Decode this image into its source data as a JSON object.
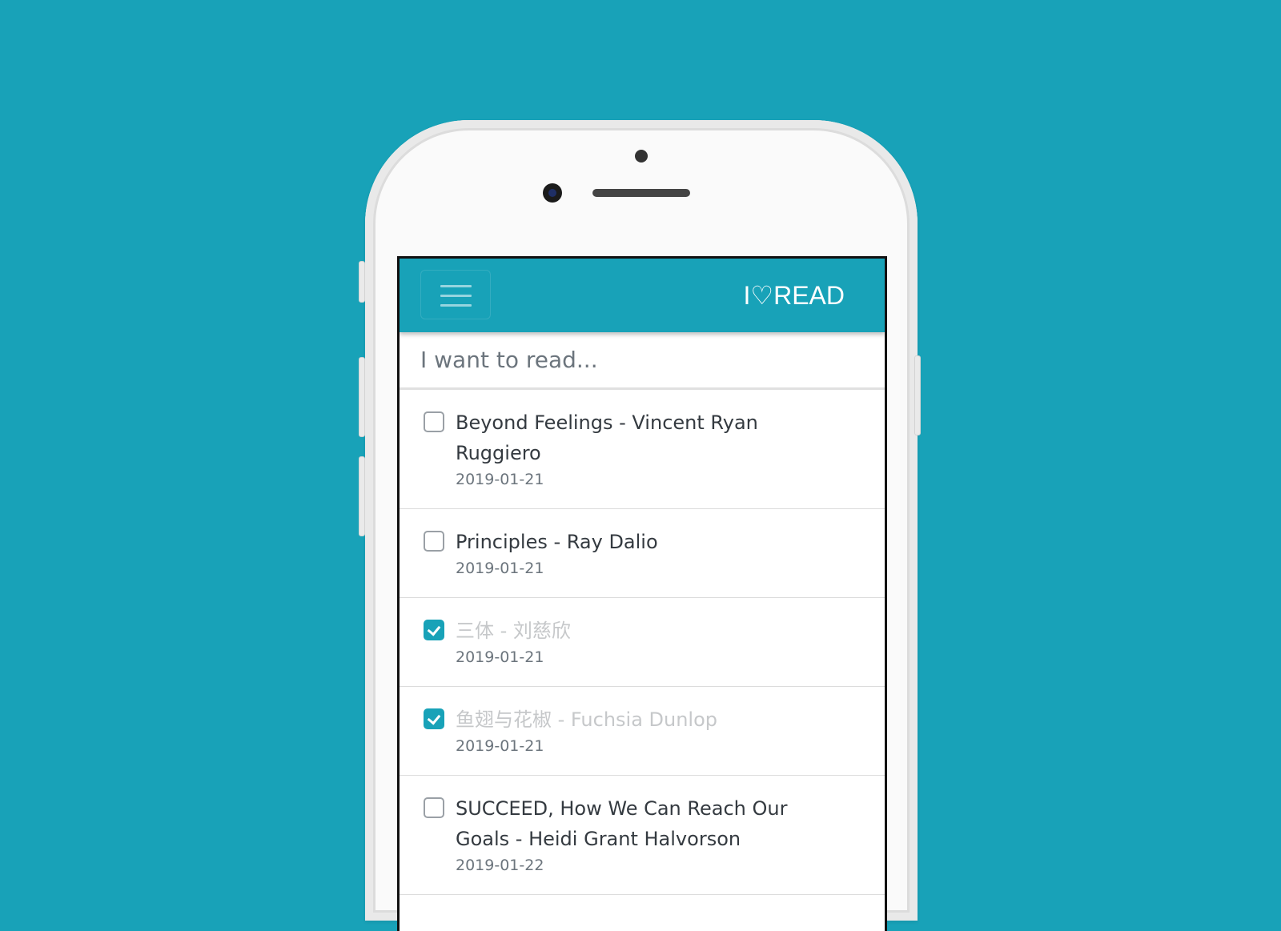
{
  "app": {
    "brand_prefix": "I",
    "brand_heart": "♡",
    "brand_suffix": "READ",
    "accent_color": "#18a2b8",
    "background_color": "#18a2b8"
  },
  "search": {
    "placeholder": "I want to read...",
    "value": ""
  },
  "books": [
    {
      "title": "Beyond Feelings - Vincent Ryan Ruggiero",
      "date": "2019-01-21",
      "checked": false
    },
    {
      "title": "Principles - Ray Dalio",
      "date": "2019-01-21",
      "checked": false
    },
    {
      "title": "三体 - 刘慈欣",
      "date": "2019-01-21",
      "checked": true
    },
    {
      "title": "鱼翅与花椒 - Fuchsia Dunlop",
      "date": "2019-01-21",
      "checked": true
    },
    {
      "title": "SUCCEED, How We Can Reach Our Goals - Heidi Grant Halvorson",
      "date": "2019-01-22",
      "checked": false
    }
  ]
}
